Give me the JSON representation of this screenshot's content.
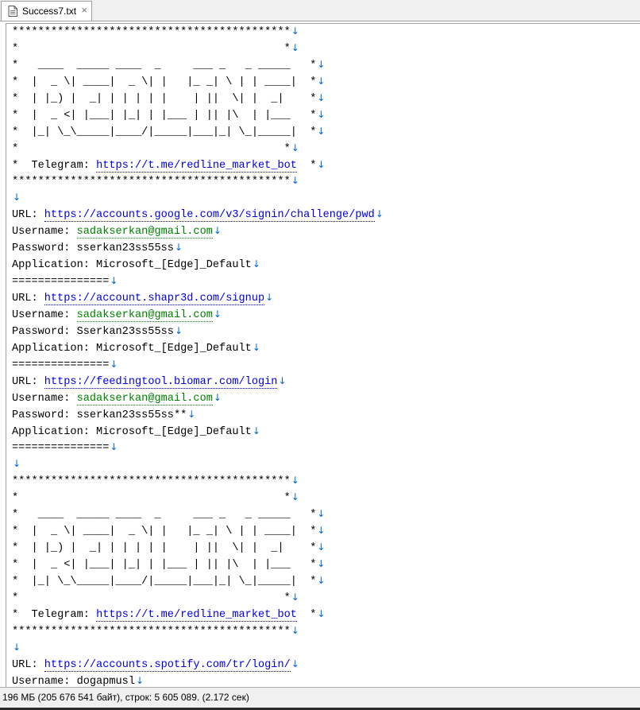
{
  "tab": {
    "title": "Success7.txt",
    "close_glyph": "×",
    "icon": "text-file-icon"
  },
  "editor": {
    "eol_glyph": "↓",
    "lines": [
      {
        "type": "plain",
        "text": "*******************************************"
      },
      {
        "type": "plain",
        "text": "*                                         *"
      },
      {
        "type": "plain",
        "text": "*   ____  _____ ____  _     ___ _   _ _____   *"
      },
      {
        "type": "plain",
        "text": "*  |  _ \\| ____|  _ \\| |   |_ _| \\ | | ____|  *"
      },
      {
        "type": "plain",
        "text": "*  | |_) |  _| | | | | |    | ||  \\| |  _|    *"
      },
      {
        "type": "plain",
        "text": "*  |  _ <| |___| |_| | |___ | || |\\  | |___   *"
      },
      {
        "type": "plain",
        "text": "*  |_| \\_\\_____|____/|_____|___|_| \\_|_____|  *"
      },
      {
        "type": "plain",
        "text": "*                                         *"
      },
      {
        "type": "link",
        "prefix": "*  Telegram: ",
        "url": "https://t.me/redline_market_bot",
        "suffix": "  *"
      },
      {
        "type": "plain",
        "text": "*******************************************"
      },
      {
        "type": "plain",
        "text": ""
      },
      {
        "type": "link",
        "prefix": "URL: ",
        "url": "https://accounts.google.com/v3/signin/challenge/pwd",
        "suffix": ""
      },
      {
        "type": "mail",
        "prefix": "Username: ",
        "email": "sadakserkan@gmail.com"
      },
      {
        "type": "plain",
        "text": "Password: sserkan23ss55ss"
      },
      {
        "type": "plain",
        "text": "Application: Microsoft_[Edge]_Default"
      },
      {
        "type": "plain",
        "text": "==============="
      },
      {
        "type": "link",
        "prefix": "URL: ",
        "url": "https://account.shapr3d.com/signup",
        "suffix": ""
      },
      {
        "type": "mail",
        "prefix": "Username: ",
        "email": "sadakserkan@gmail.com"
      },
      {
        "type": "plain",
        "text": "Password: Sserkan23ss55ss"
      },
      {
        "type": "plain",
        "text": "Application: Microsoft_[Edge]_Default"
      },
      {
        "type": "plain",
        "text": "==============="
      },
      {
        "type": "link",
        "prefix": "URL: ",
        "url": "https://feedingtool.biomar.com/login",
        "suffix": ""
      },
      {
        "type": "mail",
        "prefix": "Username: ",
        "email": "sadakserkan@gmail.com"
      },
      {
        "type": "plain",
        "text": "Password: sserkan23ss55ss**"
      },
      {
        "type": "plain",
        "text": "Application: Microsoft_[Edge]_Default"
      },
      {
        "type": "plain",
        "text": "==============="
      },
      {
        "type": "plain",
        "text": ""
      },
      {
        "type": "plain",
        "text": "*******************************************"
      },
      {
        "type": "plain",
        "text": "*                                         *"
      },
      {
        "type": "plain",
        "text": "*   ____  _____ ____  _     ___ _   _ _____   *"
      },
      {
        "type": "plain",
        "text": "*  |  _ \\| ____|  _ \\| |   |_ _| \\ | | ____|  *"
      },
      {
        "type": "plain",
        "text": "*  | |_) |  _| | | | | |    | ||  \\| |  _|    *"
      },
      {
        "type": "plain",
        "text": "*  |  _ <| |___| |_| | |___ | || |\\  | |___   *"
      },
      {
        "type": "plain",
        "text": "*  |_| \\_\\_____|____/|_____|___|_| \\_|_____|  *"
      },
      {
        "type": "plain",
        "text": "*                                         *"
      },
      {
        "type": "link",
        "prefix": "*  Telegram: ",
        "url": "https://t.me/redline_market_bot",
        "suffix": "  *"
      },
      {
        "type": "plain",
        "text": "*******************************************"
      },
      {
        "type": "plain",
        "text": ""
      },
      {
        "type": "link",
        "prefix": "URL: ",
        "url": "https://accounts.spotify.com/tr/login/",
        "suffix": ""
      },
      {
        "type": "plain",
        "text": "Username: dogapmusl"
      }
    ]
  },
  "status": {
    "text": "196 МБ (205 676 541 байт), строк: 5 605 089. (2.172 сек)"
  },
  "colors": {
    "link": "#0000dd",
    "email": "#008000",
    "eol": "#0066cc"
  }
}
